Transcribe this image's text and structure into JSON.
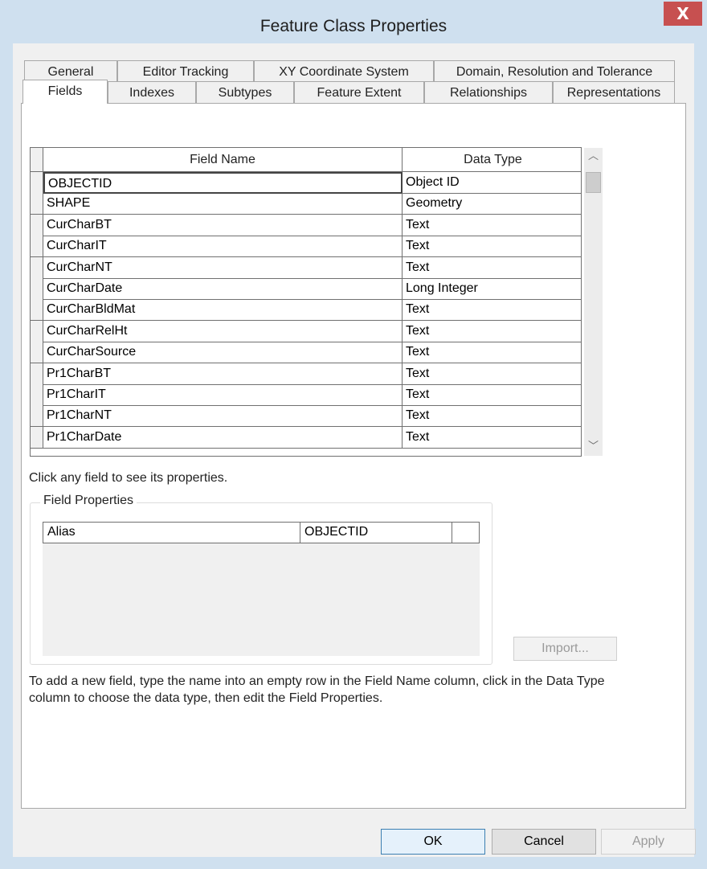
{
  "window": {
    "title": "Feature Class Properties",
    "close_label": "X"
  },
  "tabs_row1": [
    {
      "label": "General"
    },
    {
      "label": "Editor Tracking"
    },
    {
      "label": "XY Coordinate System"
    },
    {
      "label": "Domain, Resolution and Tolerance"
    }
  ],
  "tabs_row2": [
    {
      "label": "Fields",
      "selected": true
    },
    {
      "label": "Indexes"
    },
    {
      "label": "Subtypes"
    },
    {
      "label": "Feature Extent"
    },
    {
      "label": "Relationships"
    },
    {
      "label": "Representations"
    }
  ],
  "fields_grid": {
    "columns": {
      "name": "Field Name",
      "type": "Data Type"
    },
    "rows": [
      {
        "name": "OBJECTID",
        "type": "Object ID"
      },
      {
        "name": "SHAPE",
        "type": "Geometry"
      },
      {
        "name": "CurCharBT",
        "type": "Text"
      },
      {
        "name": "CurCharIT",
        "type": "Text"
      },
      {
        "name": "CurCharNT",
        "type": "Text"
      },
      {
        "name": "CurCharDate",
        "type": "Long Integer"
      },
      {
        "name": "CurCharBldMat",
        "type": "Text"
      },
      {
        "name": "CurCharRelHt",
        "type": "Text"
      },
      {
        "name": "CurCharSource",
        "type": "Text"
      },
      {
        "name": "Pr1CharBT",
        "type": "Text"
      },
      {
        "name": "Pr1CharIT",
        "type": "Text"
      },
      {
        "name": "Pr1CharNT",
        "type": "Text"
      },
      {
        "name": "Pr1CharDate",
        "type": "Text"
      }
    ]
  },
  "hint": "Click any field to see its properties.",
  "field_properties": {
    "title": "Field Properties",
    "rows": [
      {
        "label": "Alias",
        "value": "OBJECTID"
      }
    ]
  },
  "import_label": "Import...",
  "instructions": "To add a new field, type the name into an empty row in the Field Name column, click in the Data Type column to choose the data type, then edit the Field Properties.",
  "buttons": {
    "ok": "OK",
    "cancel": "Cancel",
    "apply": "Apply"
  },
  "icons": {
    "scroll_up": "chevron-up-icon",
    "scroll_down": "chevron-down-icon"
  },
  "colors": {
    "title_bar": "#cfe0ef",
    "close_button": "#c75050",
    "panel": "#ffffff"
  }
}
